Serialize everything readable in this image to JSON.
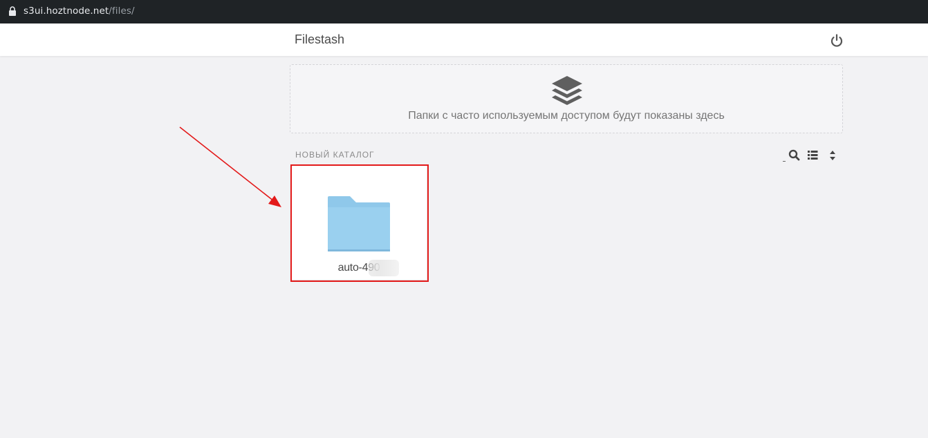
{
  "browser": {
    "url_host": "s3ui.hoztnode.net",
    "url_path": "/files/"
  },
  "header": {
    "title": "Filestash"
  },
  "frequent": {
    "message": "Папки с часто используемым доступом будут показаны здесь"
  },
  "listing": {
    "section_label": "НОВЫЙ КАТАЛОГ",
    "items": [
      {
        "name": "auto-490"
      }
    ]
  },
  "colors": {
    "folder": "#8fc8ea",
    "annotation": "#e31a1a"
  }
}
